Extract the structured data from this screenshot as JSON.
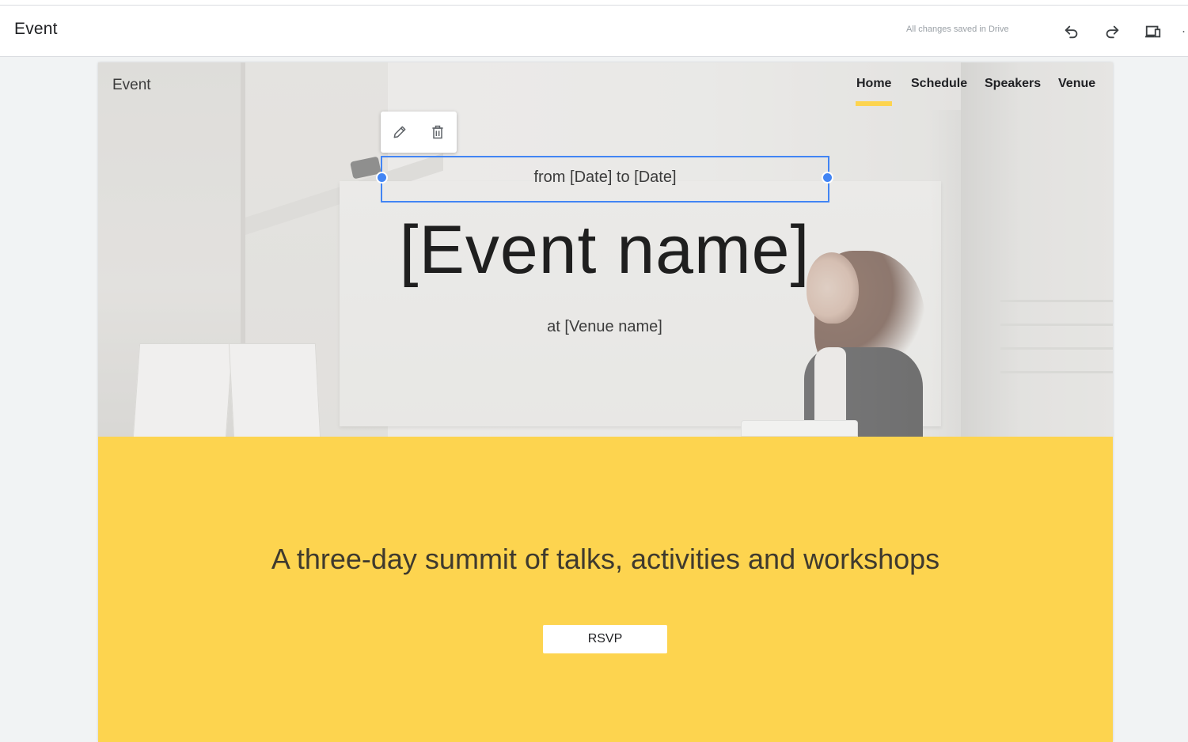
{
  "app": {
    "title": "Event",
    "save_status": "All changes saved in Drive"
  },
  "toolbar": {
    "undo_icon": "undo-icon",
    "redo_icon": "redo-icon",
    "preview_icon": "preview-devices-icon",
    "more_icon": "more-icon"
  },
  "site": {
    "title": "Event",
    "nav": [
      {
        "label": "Home",
        "active": true
      },
      {
        "label": "Schedule",
        "active": false
      },
      {
        "label": "Speakers",
        "active": false
      },
      {
        "label": "Venue",
        "active": false
      }
    ],
    "accent": "#fdd44f",
    "selection_color": "#4285f4"
  },
  "hero": {
    "date_text": "from [Date] to [Date]",
    "event_name": "[Event name]",
    "venue_text": "at [Venue name]"
  },
  "edit_toolbar": {
    "edit_icon": "pencil-icon",
    "delete_icon": "trash-icon"
  },
  "section": {
    "tagline": "A three-day summit of talks, activities and workshops",
    "button_label": "RSVP"
  }
}
